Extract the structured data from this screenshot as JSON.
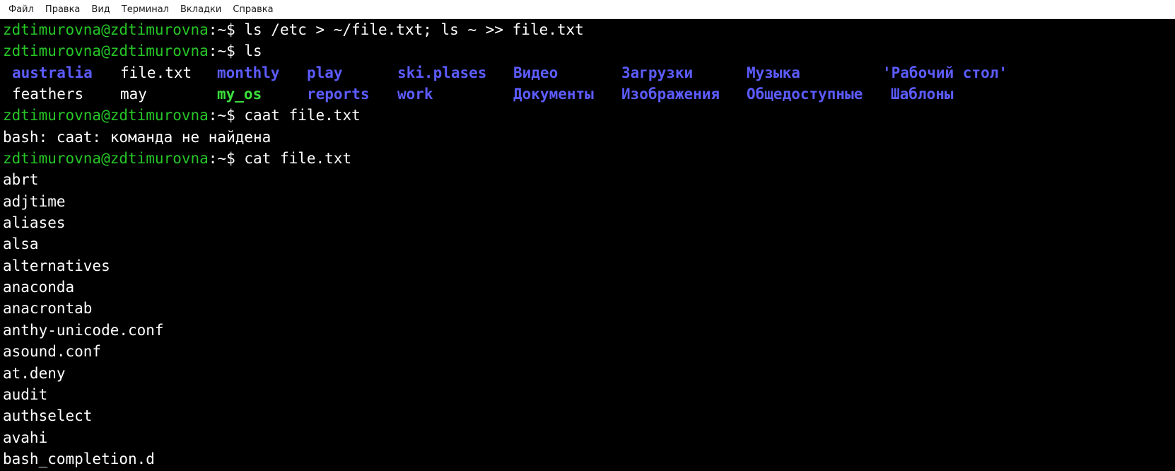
{
  "menubar": {
    "items": [
      "Файл",
      "Правка",
      "Вид",
      "Терминал",
      "Вкладки",
      "Справка"
    ]
  },
  "prompt": {
    "user_host": "zdtimurovna@zdtimurovna",
    "suffix": ":~$ "
  },
  "commands": {
    "cmd1": "ls /etc > ~/file.txt; ls ~ >> file.txt",
    "cmd2": "ls",
    "cmd3": "caat file.txt",
    "cmd4": "cat file.txt"
  },
  "ls_output": {
    "row1": [
      {
        "name": "australia",
        "kind": "dir"
      },
      {
        "name": "file.txt",
        "kind": "file"
      },
      {
        "name": "monthly",
        "kind": "dir"
      },
      {
        "name": "play",
        "kind": "dir"
      },
      {
        "name": "ski.plases",
        "kind": "dir"
      },
      {
        "name": "Видео",
        "kind": "dir"
      },
      {
        "name": "Загрузки",
        "kind": "dir"
      },
      {
        "name": "Музыка",
        "kind": "dir"
      },
      {
        "name": "'Рабочий стол'",
        "kind": "dir"
      }
    ],
    "row2": [
      {
        "name": "feathers",
        "kind": "file"
      },
      {
        "name": "may",
        "kind": "file"
      },
      {
        "name": "my_os",
        "kind": "dir-green"
      },
      {
        "name": "reports",
        "kind": "dir"
      },
      {
        "name": "work",
        "kind": "dir"
      },
      {
        "name": "Документы",
        "kind": "dir"
      },
      {
        "name": "Изображения",
        "kind": "dir"
      },
      {
        "name": "Общедоступные",
        "kind": "dir"
      },
      {
        "name": "Шаблоны",
        "kind": "dir"
      }
    ]
  },
  "error_line": "bash: caat: команда не найдена",
  "cat_output": [
    "abrt",
    "adjtime",
    "aliases",
    "alsa",
    "alternatives",
    "anaconda",
    "anacrontab",
    "anthy-unicode.conf",
    "asound.conf",
    "at.deny",
    "audit",
    "authselect",
    "avahi",
    "bash_completion.d"
  ],
  "colors": {
    "background": "#000000",
    "prompt_green": "#26c626",
    "dir_blue": "#5c5cff",
    "exec_green": "#3ce03c",
    "text": "#ffffff"
  }
}
